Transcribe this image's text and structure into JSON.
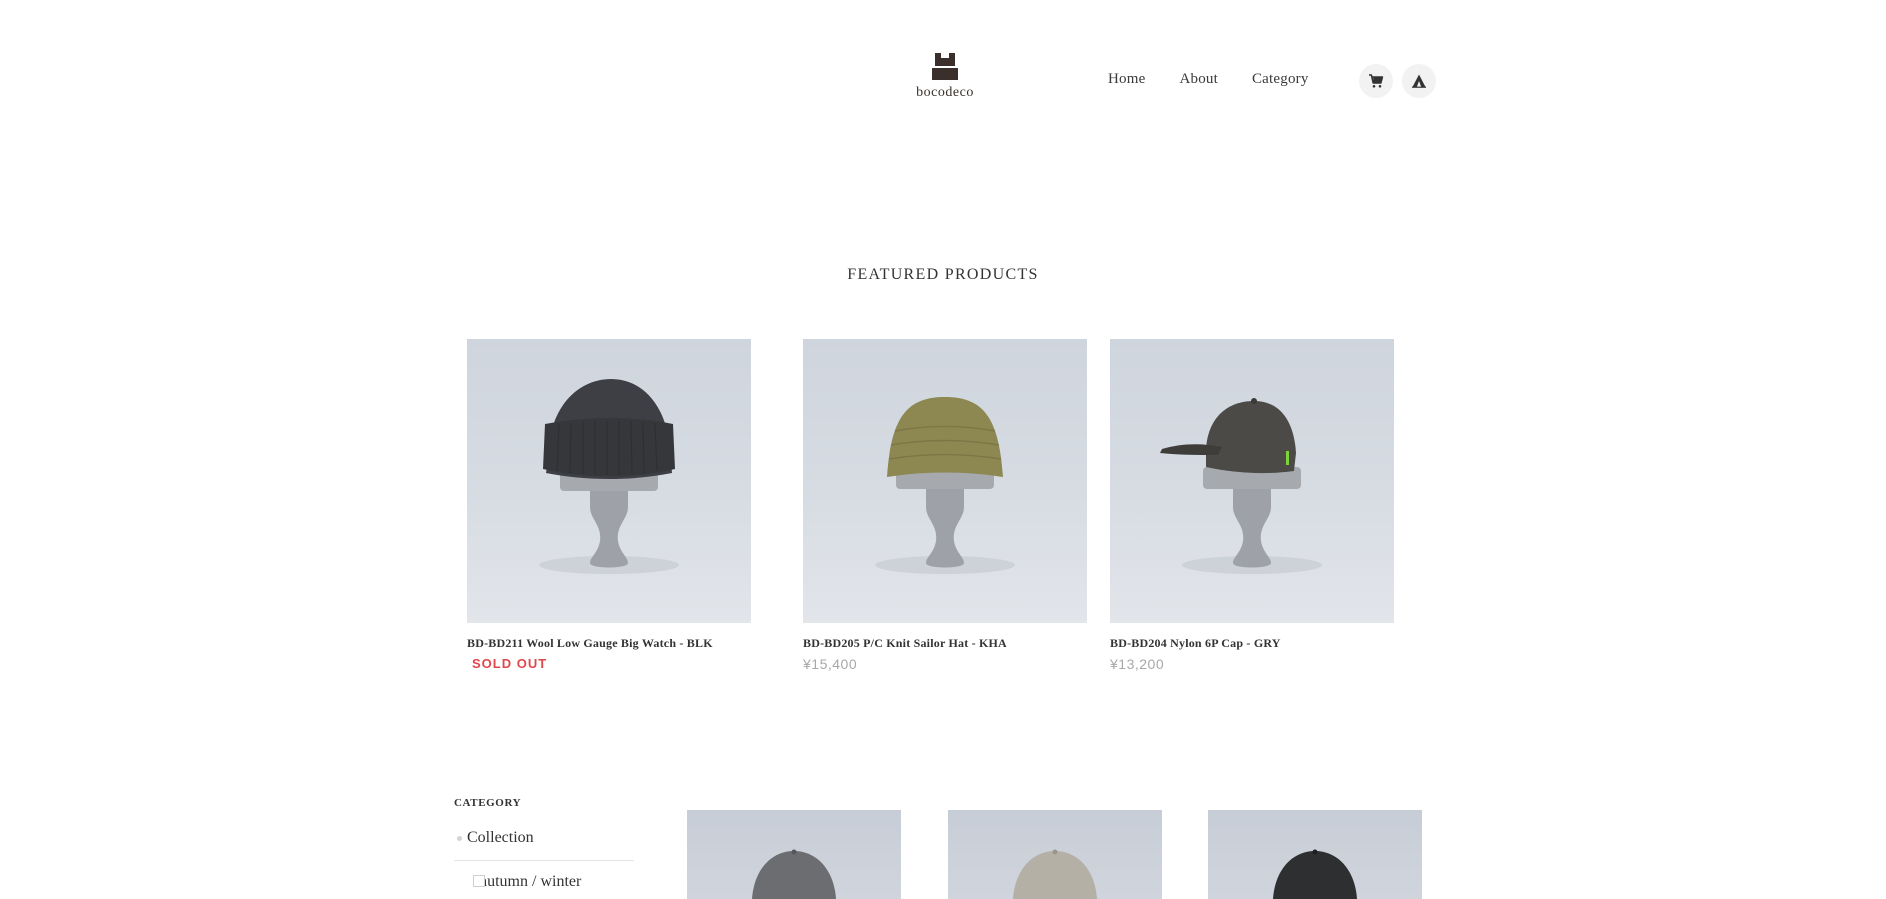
{
  "brand": {
    "name": "bocodeco",
    "logo_icon": "castle-icon",
    "color": "#3a2f2a"
  },
  "nav": {
    "items": [
      {
        "label": "Home"
      },
      {
        "label": "About"
      },
      {
        "label": "Category"
      }
    ],
    "cart_icon": "cart-icon",
    "secondary_icon": "tent-icon"
  },
  "featured": {
    "title": "FEATURED PRODUCTS",
    "products": [
      {
        "name": "BD-BD211 Wool Low Gauge Big Watch - BLK",
        "status": "SOLD OUT",
        "hat_color": "#3d3f44"
      },
      {
        "name": "BD-BD205 P/C Knit Sailor Hat - KHA",
        "price": "¥15,400",
        "hat_color": "#8d8752"
      },
      {
        "name": "BD-BD204 Nylon 6P Cap - GRY",
        "price": "¥13,200",
        "hat_color": "#4b4a46"
      }
    ],
    "sold_out_color": "#e0474c"
  },
  "sidebar": {
    "heading": "CATEGORY",
    "items": [
      {
        "label": "Collection",
        "children": [
          {
            "label": "autumn / winter"
          }
        ]
      }
    ]
  },
  "grid": {
    "items": [
      {
        "hat_color": "#6b6d70"
      },
      {
        "hat_color": "#b4b0a5"
      },
      {
        "hat_color": "#2e2f31"
      }
    ]
  }
}
